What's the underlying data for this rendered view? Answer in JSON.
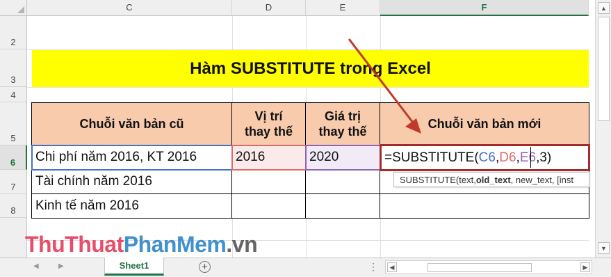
{
  "columns": [
    "C",
    "D",
    "E",
    "F"
  ],
  "rows": [
    "2",
    "3",
    "4",
    "5",
    "6",
    "7",
    "8"
  ],
  "title": "Hàm SUBSTITUTE trong Excel",
  "headers": {
    "c": "Chuỗi văn bản cũ",
    "d_line1": "Vị trí",
    "d_line2": "thay thế",
    "e_line1": "Giá trị",
    "e_line2": "thay thế",
    "f": "Chuỗi văn bản mới"
  },
  "data_rows": [
    {
      "c": "Chi phí năm 2016, KT 2016",
      "d": "2016",
      "e": "2020"
    },
    {
      "c": "Tài chính năm 2016",
      "d": "",
      "e": ""
    },
    {
      "c": "Kinh tế năm 2016",
      "d": "",
      "e": ""
    }
  ],
  "formula": {
    "prefix": "=SUBSTITUTE(",
    "arg1": "C6",
    "sep1": ",",
    "arg2": "D6",
    "sep2": ",",
    "arg3": "E6",
    "suffix": ",3)"
  },
  "tooltip": {
    "fn": "SUBSTITUTE(",
    "a1": "text, ",
    "a2": "old_text",
    "a3": ", new_text, [inst"
  },
  "watermark": {
    "part1": "ThuThuat",
    "part2": "PhanMem",
    "part3": ".vn"
  },
  "sheet_tab": "Sheet1",
  "colors": {
    "title_bg": "#ffff00",
    "header_bg": "#f8cbad",
    "excel_green": "#217346",
    "ref_blue": "#4472c4",
    "ref_red": "#e26a6a",
    "ref_purple": "#8e63b8",
    "arrow": "#c0392b"
  }
}
